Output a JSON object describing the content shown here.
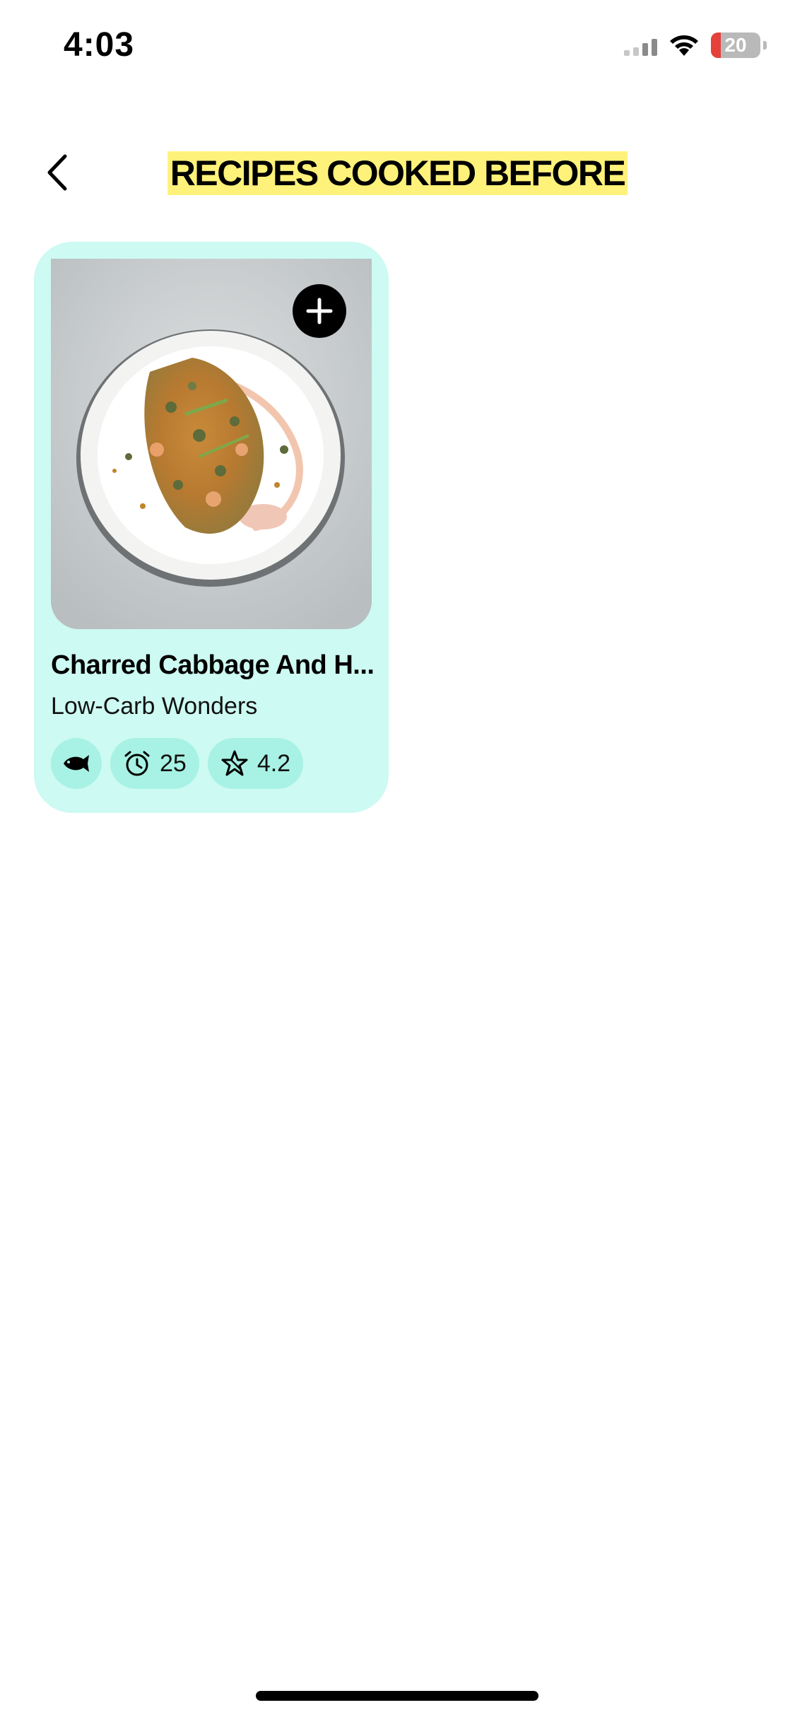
{
  "status_bar": {
    "time": "4:03",
    "battery_level": "20",
    "battery_fraction": 0.2,
    "icons": [
      "cellular-signal-icon",
      "wifi-icon",
      "battery-icon"
    ]
  },
  "header": {
    "title": "RECIPES COOKED BEFORE",
    "title_highlight_color": "#fff27a",
    "back_icon": "chevron-left-icon"
  },
  "recipes": [
    {
      "title": "Charred Cabbage And H...",
      "subtitle": "Low-Carb Wonders",
      "card_color": "#cdfaf2",
      "chip_color": "#a7f2e4",
      "add_icon": "plus-icon",
      "chips": {
        "protein_icon": "fish-icon",
        "time_icon": "alarm-clock-icon",
        "time": "25",
        "rating_icon": "star-icon",
        "rating": "4.2"
      }
    }
  ]
}
